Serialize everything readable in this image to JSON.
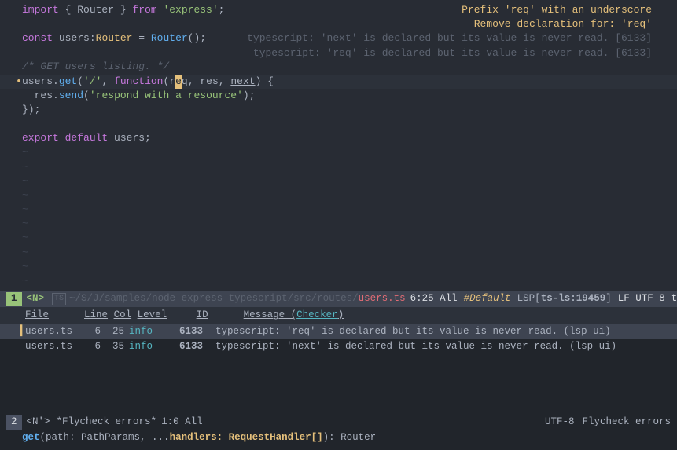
{
  "overlay": {
    "fix1": "Prefix 'req' with an underscore",
    "fix2": "Remove declaration for: 'req'",
    "diag1_prefix": "typescript: ",
    "diag1_msg": "'next' is declared but its value is never read. ",
    "diag1_code": "[6133]",
    "diag2_prefix": "typescript: ",
    "diag2_msg": "'req' is declared but its value is never read. ",
    "diag2_code": "[6133]"
  },
  "code": {
    "l1_import": "import ",
    "l1_brace": "{ Router } ",
    "l1_from": "from ",
    "l1_mod": "'express'",
    "l1_semi": ";",
    "l3_const": "const ",
    "l3_name": "users",
    "l3_colon": ":",
    "l3_type": "Router",
    "l3_eq": " = ",
    "l3_call": "Router",
    "l3_paren": "();",
    "l5_comment": "/* GET users listing. */",
    "l6_users": "users",
    "l6_dot": ".",
    "l6_get": "get",
    "l6_open": "(",
    "l6_path": "'/'",
    "l6_comma1": ", ",
    "l6_fn": "function",
    "l6_popen": "(",
    "l6_req_r": "r",
    "l6_req_e": "e",
    "l6_req_q": "q",
    "l6_c2": ", ",
    "l6_res": "res",
    "l6_c3": ", ",
    "l6_next": "next",
    "l6_pclose": ")",
    "l6_brace": " {",
    "l7_indent": "  ",
    "l7_res": "res",
    "l7_dot": ".",
    "l7_send": "send",
    "l7_open": "(",
    "l7_str": "'respond with a resource'",
    "l7_close": ");",
    "l8": "});",
    "l10_export": "export ",
    "l10_default": "default ",
    "l10_users": "users;",
    "tilde": "~"
  },
  "modeline1": {
    "num": "1",
    "mode": "<N>",
    "ts_icon": "TS",
    "path_pre": "~/S/J/samples/",
    "path_mid": "node-express-typescript/src/routes/",
    "file": "users.ts",
    "pos": "6:25 All",
    "default": "#Default",
    "lsp": "LSP[",
    "lsp_name": "ts-ls:19459",
    "lsp_end": "]",
    "enc": "LF UTF-8",
    "major": "typescri"
  },
  "errheader": {
    "file": "File",
    "line": "Line",
    "col": "Col",
    "level": "Level",
    "id": "ID",
    "message": "Message (",
    "checker": "Checker",
    "close": ")"
  },
  "errors": [
    {
      "file": "users.ts",
      "line": "6",
      "col": "25",
      "level": "info",
      "id": "6133",
      "msg": "typescript: 'req' is declared but its value is never read. (lsp-ui)"
    },
    {
      "file": "users.ts",
      "line": "6",
      "col": "35",
      "level": "info",
      "id": "6133",
      "msg": "typescript: 'next' is declared but its value is never read. (lsp-ui)"
    }
  ],
  "modeline2": {
    "num": "2",
    "mode": "<N'>",
    "buf": "*Flycheck errors*",
    "pos": "1:0 All",
    "enc": "UTF-8",
    "major": "Flycheck errors"
  },
  "minibuf": {
    "fn": "get",
    "open": "(path: PathParams, ",
    "dots": "...",
    "active": "handlers: RequestHandler[]",
    "close": "): Router"
  }
}
